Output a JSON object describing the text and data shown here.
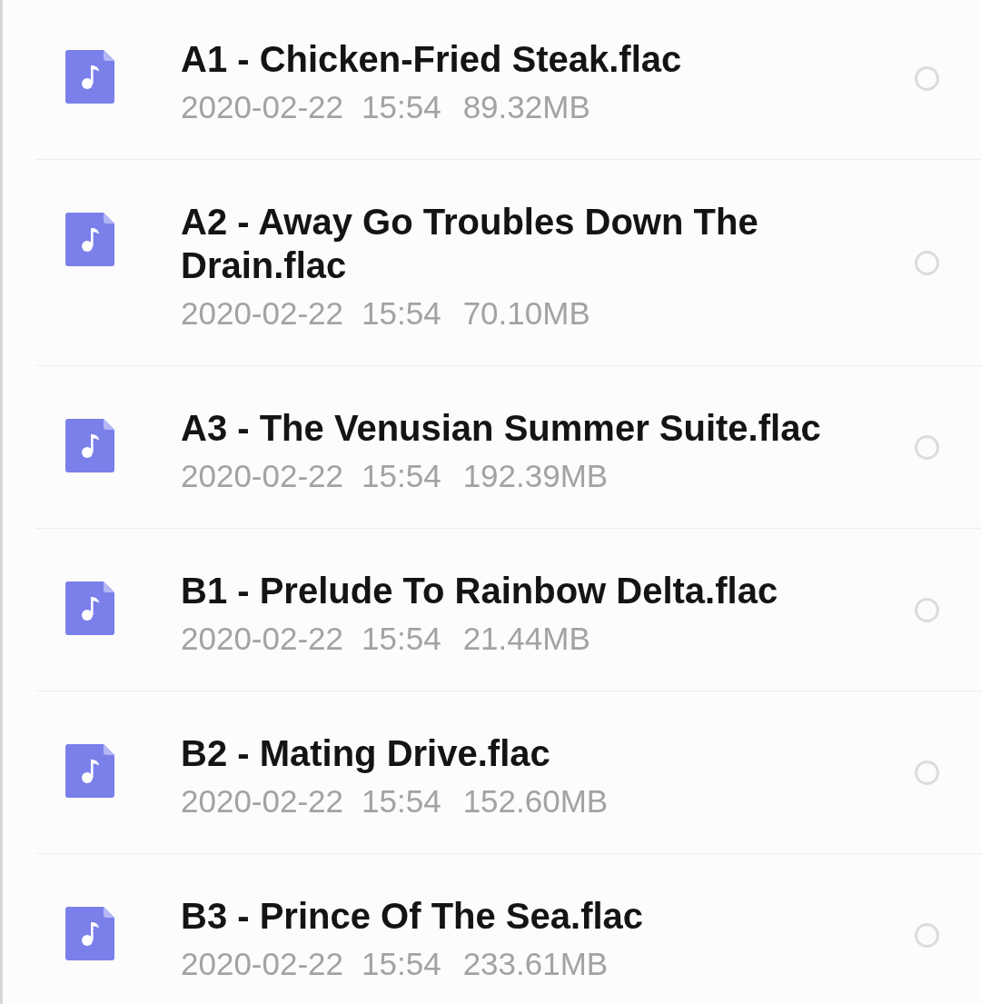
{
  "files": [
    {
      "name": "A1 - Chicken-Fried Steak.flac",
      "date": "2020-02-22",
      "time": "15:54",
      "size": "89.32MB",
      "selected": false
    },
    {
      "name": "A2 - Away Go Troubles Down The Drain.flac",
      "date": "2020-02-22",
      "time": "15:54",
      "size": "70.10MB",
      "selected": false
    },
    {
      "name": "A3 - The Venusian Summer Suite.flac",
      "date": "2020-02-22",
      "time": "15:54",
      "size": "192.39MB",
      "selected": false
    },
    {
      "name": "B1 - Prelude To Rainbow Delta.flac",
      "date": "2020-02-22",
      "time": "15:54",
      "size": "21.44MB",
      "selected": false
    },
    {
      "name": "B2 - Mating Drive.flac",
      "date": "2020-02-22",
      "time": "15:54",
      "size": "152.60MB",
      "selected": false
    },
    {
      "name": "B3 - Prince Of The Sea.flac",
      "date": "2020-02-22",
      "time": "15:54",
      "size": "233.61MB",
      "selected": false
    }
  ]
}
